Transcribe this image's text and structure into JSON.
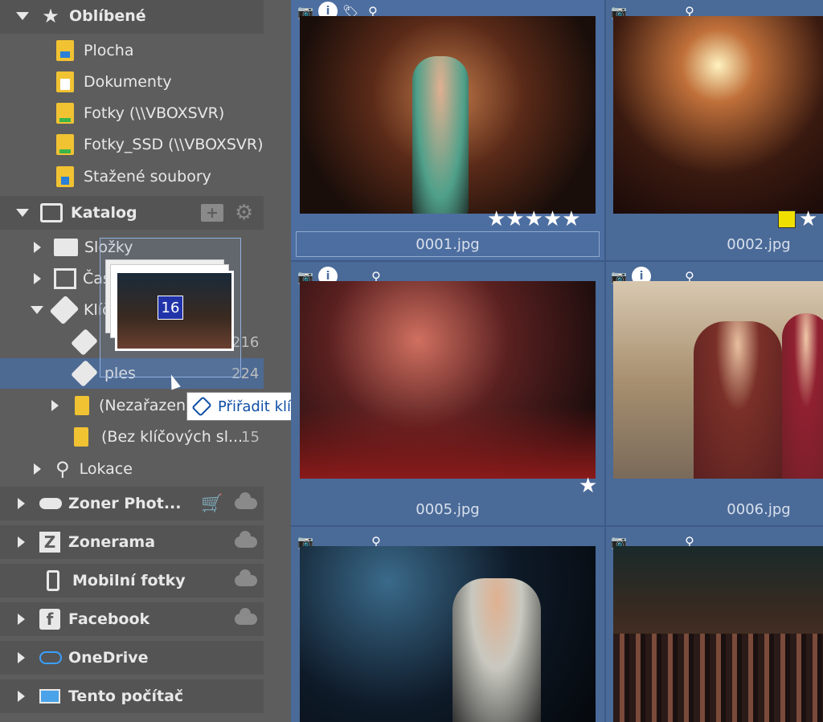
{
  "sidebar": {
    "favorites": {
      "label": "Oblíbené",
      "items": [
        {
          "label": "Plocha"
        },
        {
          "label": "Dokumenty"
        },
        {
          "label": "Fotky (\\\\VBOXSVR)"
        },
        {
          "label": "Fotky_SSD (\\\\VBOXSVR)"
        },
        {
          "label": "Stažené soubory"
        }
      ]
    },
    "catalog": {
      "label": "Katalog",
      "items": {
        "folders": "Složky",
        "timeline": "Časová osa",
        "keywords": "Klíčová slova",
        "kw1_count": "216",
        "kw2_label": "ples",
        "kw2_count": "224",
        "unsorted": "(Nezařazen",
        "nokw": "(Bez klíčových sl...",
        "nokw_count": "15",
        "location": "Lokace"
      }
    },
    "services": [
      {
        "label": "Zoner Phot..."
      },
      {
        "label": "Zonerama"
      },
      {
        "label": "Mobilní fotky"
      },
      {
        "label": "Facebook"
      },
      {
        "label": "OneDrive"
      },
      {
        "label": "Tento počítač"
      }
    ]
  },
  "drag": {
    "count": "16"
  },
  "tooltip": {
    "text": "Přiřadit klíčové slovo ples"
  },
  "grid": {
    "files": [
      {
        "name": "0001.jpg"
      },
      {
        "name": "0002.jpg"
      },
      {
        "name": "0005.jpg"
      },
      {
        "name": "0006.jpg"
      }
    ]
  },
  "colors": {
    "accent": "#4a6a98",
    "selection": "#4d6a93",
    "sidebar": "#5d5d5d",
    "tooltip_text": "#0e4fa7",
    "yellow_label": "#f0e000"
  }
}
